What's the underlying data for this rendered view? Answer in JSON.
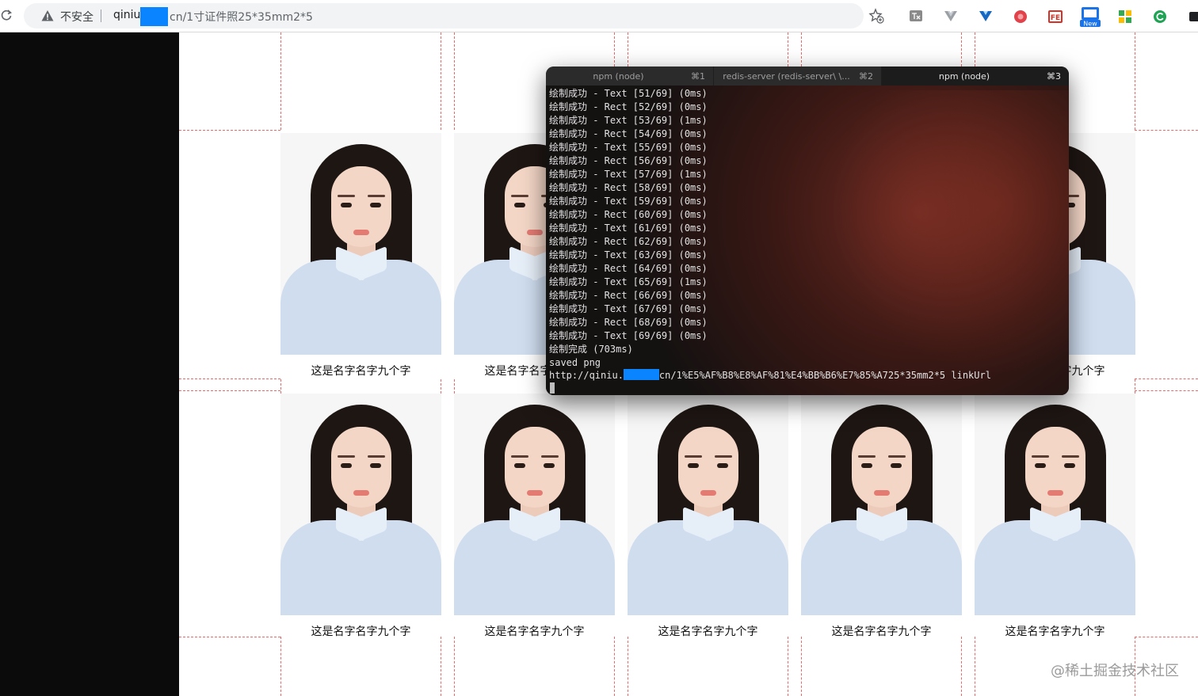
{
  "browser": {
    "security_label": "不安全",
    "url_host": "qiniu.",
    "url_path": "cn/1寸证件照25*35mm2*5",
    "toolbar_icons": [
      "star-add-icon",
      "translate-icon",
      "vue-devtools-icon",
      "vuetify-icon",
      "extension-red-icon",
      "fe-extension-icon",
      "new-extension-icon",
      "grid-extension-icon",
      "refresh-green-icon"
    ],
    "new_badge": "New",
    "fe_label": "FE"
  },
  "photos": {
    "caption": "这是名字名字九个字",
    "count_per_row": 5,
    "rows": 2
  },
  "terminal": {
    "tabs": [
      {
        "name": "npm (node)",
        "shortcut": "⌘1",
        "active": false
      },
      {
        "name": "redis-server (redis-server\\ \\...",
        "shortcut": "⌘2",
        "active": false
      },
      {
        "name": "npm (node)",
        "shortcut": "⌘3",
        "active": true
      }
    ],
    "lines": [
      "绘制成功 - Text [51/69] (0ms)",
      "绘制成功 - Rect [52/69] (0ms)",
      "绘制成功 - Text [53/69] (1ms)",
      "绘制成功 - Rect [54/69] (0ms)",
      "绘制成功 - Text [55/69] (0ms)",
      "绘制成功 - Rect [56/69] (0ms)",
      "绘制成功 - Text [57/69] (1ms)",
      "绘制成功 - Rect [58/69] (0ms)",
      "绘制成功 - Text [59/69] (0ms)",
      "绘制成功 - Rect [60/69] (0ms)",
      "绘制成功 - Text [61/69] (0ms)",
      "绘制成功 - Rect [62/69] (0ms)",
      "绘制成功 - Text [63/69] (0ms)",
      "绘制成功 - Rect [64/69] (0ms)",
      "绘制成功 - Text [65/69] (1ms)",
      "绘制成功 - Rect [66/69] (0ms)",
      "绘制成功 - Text [67/69] (0ms)",
      "绘制成功 - Rect [68/69] (0ms)",
      "绘制成功 - Text [69/69] (0ms)",
      "绘制完成 (703ms)",
      "saved png"
    ],
    "link_prefix": "http://qiniu.",
    "link_suffix": "cn/1%E5%AF%B8%E8%AF%81%E4%BB%B6%E7%85%A725*35mm2*5 linkUrl"
  },
  "watermark": "@稀土掘金技术社区"
}
